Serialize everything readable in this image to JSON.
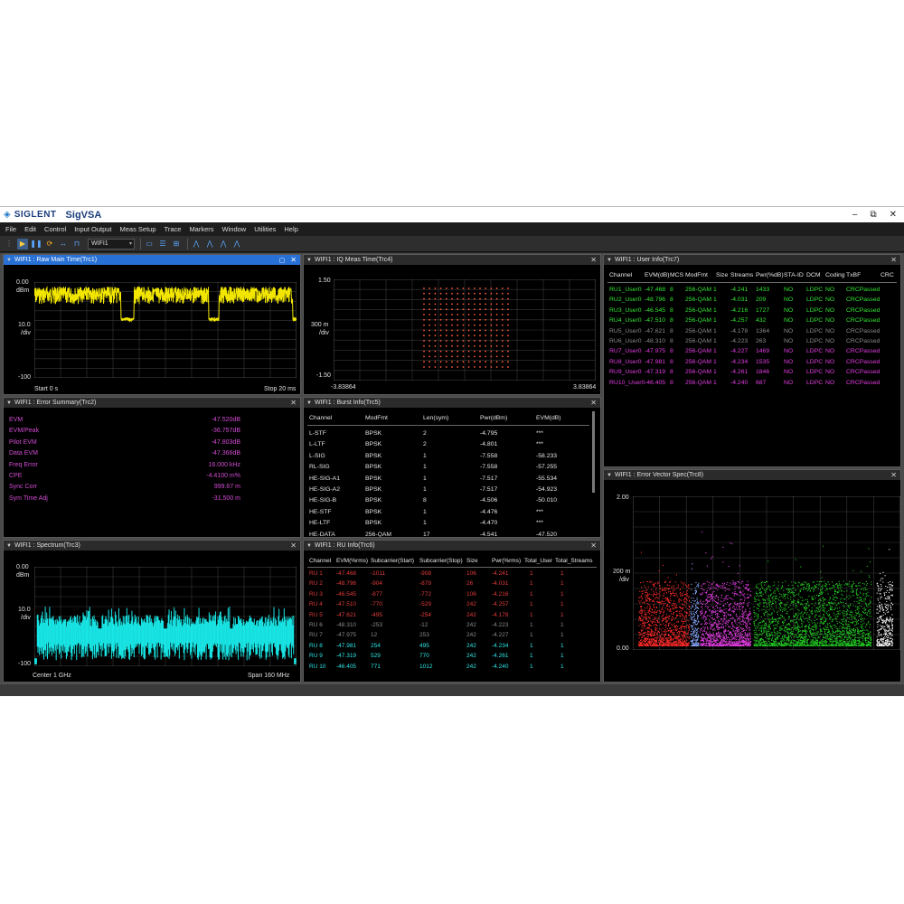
{
  "window": {
    "brand": "SIGLENT",
    "title": "SigVSA",
    "minimize": "–",
    "restore": "⧉",
    "close": "✕"
  },
  "menu": [
    "File",
    "Edit",
    "Control",
    "Input Output",
    "Meas Setup",
    "Trace",
    "Markers",
    "Window",
    "Utilities",
    "Help"
  ],
  "toolbar": {
    "meas_select": "WIFI1"
  },
  "panels": {
    "raw_main_time": {
      "title": "WIFI1 : Raw Main Time(Trc1)",
      "y_top": "0.00",
      "y_unit": "dBm",
      "y_scale": "10.0",
      "y_div": "/div",
      "y_bottom": "-100",
      "x_start": "Start  0 s",
      "x_stop": "Stop  20 ms"
    },
    "iq_meas_time": {
      "title": "WIFI1 : IQ Meas Time(Trc4)",
      "y_top": "1.50",
      "y_scale": "300 m",
      "y_div": "/div",
      "y_bottom": "-1.50",
      "x_left": "-3.83864",
      "x_right": "3.83864"
    },
    "user_info": {
      "title": "WIFI1 : User Info(Trc7)",
      "headers": [
        "Channel",
        "EVM(dB)",
        "MCS",
        "ModFmt",
        "Size",
        "Streams",
        "Pwr(%dB)",
        "STA-ID",
        "DCM",
        "Coding",
        "TxBF",
        "CRC"
      ],
      "rows": [
        {
          "channel": "RU1_User0",
          "evm": "-47.468",
          "mcs": "8",
          "modfmt": "256-QAM 1",
          "streams": "-4.241",
          "size": "1433",
          "sta": "NO",
          "coding": "LDPC",
          "txbf": "NO",
          "crc": "CRCPassed",
          "color": "#33e633"
        },
        {
          "channel": "RU2_User0",
          "evm": "-48.796",
          "mcs": "8",
          "modfmt": "256-QAM 1",
          "streams": "-4.031",
          "size": "209",
          "sta": "NO",
          "coding": "LDPC",
          "txbf": "NO",
          "crc": "CRCPassed",
          "color": "#33e633"
        },
        {
          "channel": "RU3_User0",
          "evm": "-46.545",
          "mcs": "8",
          "modfmt": "256-QAM 1",
          "streams": "-4.216",
          "size": "1727",
          "sta": "NO",
          "coding": "LDPC",
          "txbf": "NO",
          "crc": "CRCPassed",
          "color": "#33e633"
        },
        {
          "channel": "RU4_User0",
          "evm": "-47.510",
          "mcs": "8",
          "modfmt": "256-QAM 1",
          "streams": "-4.257",
          "size": "432",
          "sta": "NO",
          "coding": "LDPC",
          "txbf": "NO",
          "crc": "CRCPassed",
          "color": "#33e633"
        },
        {
          "channel": "RU5_User0",
          "evm": "-47.621",
          "mcs": "8",
          "modfmt": "256-QAM 1",
          "streams": "-4.178",
          "size": "1364",
          "sta": "NO",
          "coding": "LDPC",
          "txbf": "NO",
          "crc": "CRCPassed",
          "color": "#8a8a8a"
        },
        {
          "channel": "RU6_User0",
          "evm": "-48.310",
          "mcs": "8",
          "modfmt": "256-QAM 1",
          "streams": "-4.223",
          "size": "263",
          "sta": "NO",
          "coding": "LDPC",
          "txbf": "NO",
          "crc": "CRCPassed",
          "color": "#8a8a8a"
        },
        {
          "channel": "RU7_User0",
          "evm": "-47.975",
          "mcs": "8",
          "modfmt": "256-QAM 1",
          "streams": "-4.227",
          "size": "1469",
          "sta": "NO",
          "coding": "LDPC",
          "txbf": "NO",
          "crc": "CRCPassed",
          "color": "#e23ce2"
        },
        {
          "channel": "RU8_User0",
          "evm": "-47.981",
          "mcs": "8",
          "modfmt": "256-QAM 1",
          "streams": "-4.234",
          "size": "1535",
          "sta": "NO",
          "coding": "LDPC",
          "txbf": "NO",
          "crc": "CRCPassed",
          "color": "#e23ce2"
        },
        {
          "channel": "RU9_User0",
          "evm": "-47.319",
          "mcs": "8",
          "modfmt": "256-QAM 1",
          "streams": "-4.261",
          "size": "1846",
          "sta": "NO",
          "coding": "LDPC",
          "txbf": "NO",
          "crc": "CRCPassed",
          "color": "#e23ce2"
        },
        {
          "channel": "RU10_User0",
          "evm": "-46.405",
          "mcs": "8",
          "modfmt": "256-QAM 1",
          "streams": "-4.240",
          "size": "687",
          "sta": "NO",
          "coding": "LDPC",
          "txbf": "NO",
          "crc": "CRCPassed",
          "color": "#e23ce2"
        }
      ]
    },
    "error_summary": {
      "title": "WIFI1 : Error Summary(Trc2)",
      "rows": [
        {
          "label": "EVM",
          "value": "-47.520dB"
        },
        {
          "label": "EVM/Peak",
          "value": "-36.757dB"
        },
        {
          "label": "Pilot EVM",
          "value": "-47.803dB"
        },
        {
          "label": "Data EVM",
          "value": "-47.366dB"
        },
        {
          "label": "Freq Error",
          "value": "16.000 kHz"
        },
        {
          "label": "CPE",
          "value": "-4.4100 m%"
        },
        {
          "label": "Sync Corr",
          "value": "999.67 m"
        },
        {
          "label": "Sym Time Adj",
          "value": "-31.500 m"
        }
      ]
    },
    "burst_info": {
      "title": "WIFI1 : Burst Info(Trc5)",
      "headers": [
        "Channel",
        "ModFmt",
        "Len(sym)",
        "Pwr(dBm)",
        "EVM(dB)"
      ],
      "rows": [
        [
          "L-STF",
          "BPSK",
          "2",
          "-4.795",
          "***"
        ],
        [
          "L-LTF",
          "BPSK",
          "2",
          "-4.801",
          "***"
        ],
        [
          "L-SIG",
          "BPSK",
          "1",
          "-7.558",
          "-58.233"
        ],
        [
          "RL-SIG",
          "BPSK",
          "1",
          "-7.558",
          "-57.255"
        ],
        [
          "HE-SIG-A1",
          "BPSK",
          "1",
          "-7.517",
          "-55.534"
        ],
        [
          "HE-SIG-A2",
          "BPSK",
          "1",
          "-7.517",
          "-54.923"
        ],
        [
          "HE-SIG-B",
          "BPSK",
          "8",
          "-4.506",
          "-50.010"
        ],
        [
          "HE-STF",
          "BPSK",
          "1",
          "-4.476",
          "***"
        ],
        [
          "HE-LTF",
          "BPSK",
          "1",
          "-4.470",
          "***"
        ],
        [
          "HE-DATA",
          "256-QAM",
          "17",
          "-4.541",
          "-47.520"
        ]
      ]
    },
    "spectrum": {
      "title": "WIFI1 : Spectrum(Trc3)",
      "y_top": "0.00",
      "y_unit": "dBm",
      "y_scale": "10.0",
      "y_div": "/div",
      "y_bottom": "-100",
      "x_center": "Center  1 GHz",
      "x_span": "Span  160 MHz"
    },
    "ru_info": {
      "title": "WIFI1 : RU Info(Trc6)",
      "headers": [
        "Channel",
        "EVM(%rms)",
        "Subcarrier(Start)",
        "Subcarrier(Stop)",
        "Size",
        "Pwr(%rms)",
        "Total_User",
        "Total_Streams"
      ],
      "rows": [
        {
          "cells": [
            "RU 1",
            "-47.468",
            "-1011",
            "-908",
            "106",
            "-4.241",
            "1",
            "1"
          ],
          "color": "#e23a3a"
        },
        {
          "cells": [
            "RU 2",
            "-48.796",
            "-904",
            "-879",
            "26",
            "-4.031",
            "1",
            "1"
          ],
          "color": "#e23a3a"
        },
        {
          "cells": [
            "RU 3",
            "-46.545",
            "-877",
            "-772",
            "106",
            "-4.216",
            "1",
            "1"
          ],
          "color": "#e23a3a"
        },
        {
          "cells": [
            "RU 4",
            "-47.510",
            "-770",
            "-529",
            "242",
            "-4.257",
            "1",
            "1"
          ],
          "color": "#e23a3a"
        },
        {
          "cells": [
            "RU 5",
            "-47.621",
            "-495",
            "-254",
            "242",
            "-4.178",
            "1",
            "1"
          ],
          "color": "#e23a3a"
        },
        {
          "cells": [
            "RU 6",
            "-48.310",
            "-253",
            "-12",
            "242",
            "-4.223",
            "1",
            "1"
          ],
          "color": "#8a8a8a"
        },
        {
          "cells": [
            "RU 7",
            "-47.975",
            "12",
            "253",
            "242",
            "-4.227",
            "1",
            "1"
          ],
          "color": "#8a8a8a"
        },
        {
          "cells": [
            "RU 8",
            "-47.981",
            "254",
            "495",
            "242",
            "-4.234",
            "1",
            "1"
          ],
          "color": "#2ee6e6"
        },
        {
          "cells": [
            "RU 9",
            "-47.319",
            "529",
            "770",
            "242",
            "-4.261",
            "1",
            "1"
          ],
          "color": "#2ee6e6"
        },
        {
          "cells": [
            "RU 10",
            "-46.405",
            "771",
            "1012",
            "242",
            "-4.240",
            "1",
            "1"
          ],
          "color": "#2ee6e6"
        }
      ]
    },
    "evm_spectrum": {
      "title": "WIFI1 : Error Vector Spec(Trc8)",
      "y_top": "2.00",
      "y_scale": "200 m",
      "y_div": "/div",
      "y_bottom": "0.00"
    }
  },
  "colors": {
    "trace_yellow": "#f2e600",
    "trace_cyan": "#19e6e6",
    "iq_red": "#ff5a3c",
    "summary_magenta": "#d24bd2",
    "panel_active": "#2770d6"
  }
}
